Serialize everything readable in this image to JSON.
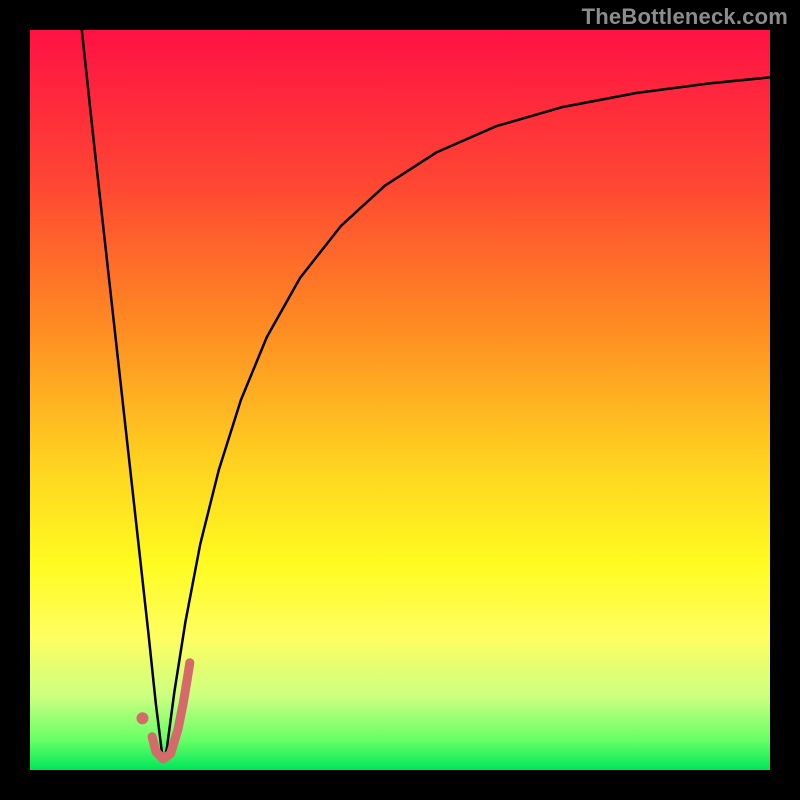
{
  "watermark": "TheBottleneck.com",
  "chart_data": {
    "type": "line",
    "title": "",
    "xlabel": "",
    "ylabel": "",
    "xlim": [
      0,
      100
    ],
    "ylim": [
      0,
      100
    ],
    "legend": false,
    "grid": false,
    "background": {
      "type": "vertical_gradient",
      "stops": [
        {
          "pos": 0.0,
          "color": "#ff1144"
        },
        {
          "pos": 0.2,
          "color": "#ff4433"
        },
        {
          "pos": 0.4,
          "color": "#ff8b22"
        },
        {
          "pos": 0.58,
          "color": "#ffd020"
        },
        {
          "pos": 0.72,
          "color": "#fffb20"
        },
        {
          "pos": 0.82,
          "color": "#fffe60"
        },
        {
          "pos": 0.9,
          "color": "#ccff80"
        },
        {
          "pos": 0.96,
          "color": "#66ff66"
        },
        {
          "pos": 1.0,
          "color": "#00e65a"
        }
      ]
    },
    "series": [
      {
        "name": "left-curve",
        "type": "line",
        "color": "#000000",
        "width": 2.5,
        "x": [
          7.0,
          8.5,
          10.0,
          11.5,
          13.0,
          14.5,
          16.0,
          17.0,
          18.0
        ],
        "y": [
          100.0,
          86.0,
          72.5,
          59.0,
          45.5,
          32.0,
          18.5,
          9.0,
          1.0
        ]
      },
      {
        "name": "right-curve",
        "type": "line",
        "color": "#000000",
        "width": 2.5,
        "x": [
          18.0,
          18.5,
          19.5,
          21.0,
          23.0,
          25.5,
          28.5,
          32.0,
          36.5,
          42.0,
          48.0,
          55.0,
          63.0,
          72.0,
          82.0,
          92.0,
          100.0
        ],
        "y": [
          1.0,
          3.0,
          10.5,
          20.0,
          30.5,
          40.5,
          50.0,
          58.5,
          66.5,
          73.5,
          79.0,
          83.5,
          87.0,
          89.6,
          91.5,
          92.8,
          93.6
        ]
      },
      {
        "name": "highlight-j",
        "type": "line",
        "color": "#d46a6a",
        "width": 9,
        "linecap": "round",
        "x": [
          16.5,
          17.0,
          18.0,
          19.0,
          20.0,
          20.7,
          21.2,
          21.6
        ],
        "y": [
          4.5,
          2.5,
          1.5,
          2.2,
          5.5,
          9.0,
          12.0,
          14.5
        ]
      },
      {
        "name": "marker-dot",
        "type": "scatter",
        "color": "#d46a6a",
        "radius": 6,
        "x": [
          15.2
        ],
        "y": [
          7.0
        ]
      }
    ]
  }
}
